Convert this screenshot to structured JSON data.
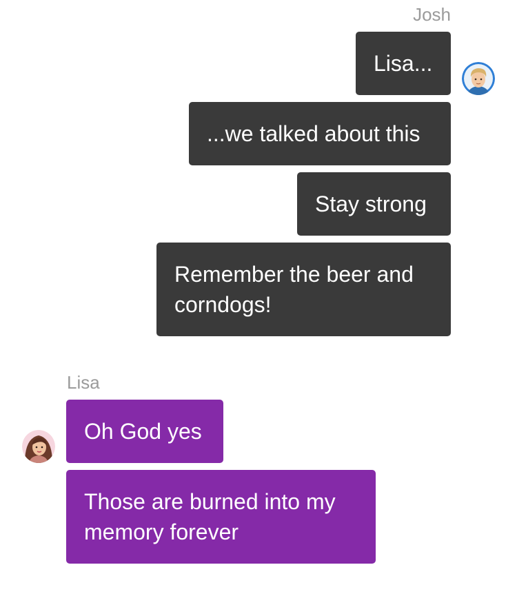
{
  "conversation": {
    "josh": {
      "name": "Josh",
      "avatar_icon": "josh-avatar-icon",
      "bubble_color": "#3a3a3a",
      "messages": [
        {
          "lines": [
            "Lisa..."
          ]
        },
        {
          "lines": [
            "...we talked about this"
          ]
        },
        {
          "lines": [
            "Stay strong"
          ]
        },
        {
          "lines": [
            "Remember the beer and",
            "corndogs!"
          ]
        }
      ]
    },
    "lisa": {
      "name": "Lisa",
      "avatar_icon": "lisa-avatar-icon",
      "bubble_color": "#852aa8",
      "messages": [
        {
          "lines": [
            "Oh God yes"
          ]
        },
        {
          "lines": [
            "Those are burned into my",
            "memory forever"
          ]
        }
      ]
    }
  }
}
